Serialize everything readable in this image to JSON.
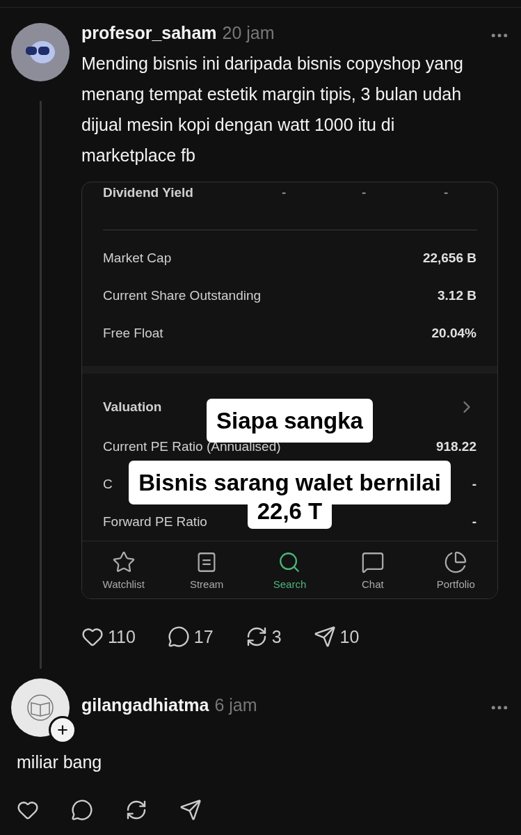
{
  "posts": [
    {
      "username": "profesor_saham",
      "time": "20 jam",
      "body": "Mending bisnis ini daripada bisnis copyshop yang menang tempat estetik margin tipis, 3 bulan udah dijual mesin kopi dengan watt 1000 itu di marketplace fb",
      "follow_badge": false,
      "attachment": {
        "dividend": {
          "label": "Dividend Yield",
          "values": [
            "-",
            "-",
            "-"
          ]
        },
        "stats": [
          {
            "label": "Market Cap",
            "value": "22,656 B"
          },
          {
            "label": "Current Share Outstanding",
            "value": "3.12 B"
          },
          {
            "label": "Free Float",
            "value": "20.04%"
          }
        ],
        "valuation": {
          "title": "Valuation",
          "rows": [
            {
              "label": "Current PE Ratio (Annualised)",
              "value": "918.22"
            },
            {
              "label": "C",
              "value": "-"
            },
            {
              "label": "Forward PE Ratio",
              "value": "-"
            }
          ]
        },
        "tabs": [
          {
            "label": "Watchlist",
            "selected": false
          },
          {
            "label": "Stream",
            "selected": false
          },
          {
            "label": "Search",
            "selected": true
          },
          {
            "label": "Chat",
            "selected": false
          },
          {
            "label": "Portfolio",
            "selected": false
          }
        ],
        "captions": [
          [
            "Siapa sangka"
          ],
          [
            "Bisnis sarang walet bernilai",
            "22,6 T"
          ]
        ]
      },
      "actions": [
        {
          "kind": "like",
          "count": "110"
        },
        {
          "kind": "reply",
          "count": "17"
        },
        {
          "kind": "repost",
          "count": "3"
        },
        {
          "kind": "share",
          "count": "10"
        }
      ]
    },
    {
      "username": "gilangadhiatma",
      "time": "6 jam",
      "body": "miliar bang",
      "follow_badge": true,
      "actions": [
        {
          "kind": "like"
        },
        {
          "kind": "reply"
        },
        {
          "kind": "repost"
        },
        {
          "kind": "share"
        }
      ]
    }
  ]
}
